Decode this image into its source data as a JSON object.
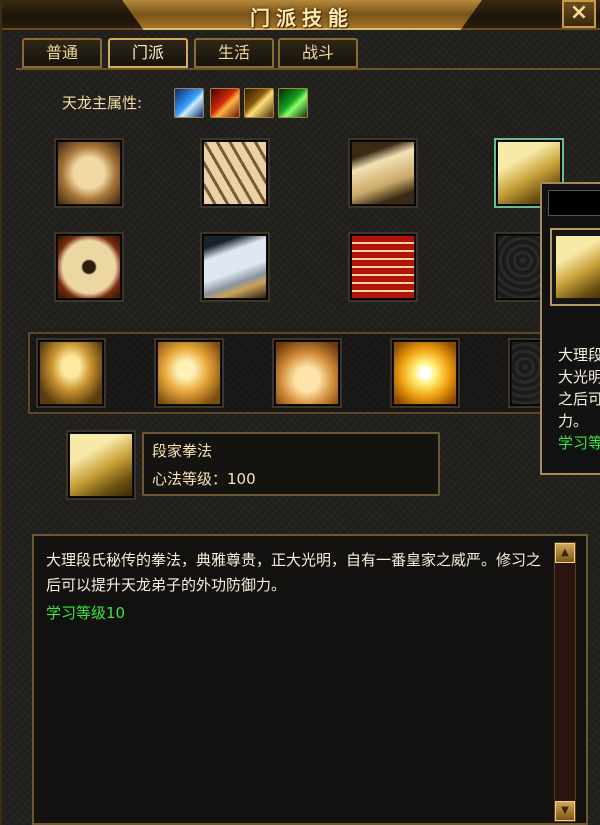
{
  "window": {
    "title": "门派技能",
    "close_label": "×"
  },
  "tabs": [
    {
      "label": "普通",
      "active": false
    },
    {
      "label": "门派",
      "active": true
    },
    {
      "label": "生活",
      "active": false
    },
    {
      "label": "战斗",
      "active": false
    }
  ],
  "attributes": {
    "label": "天龙主属性:",
    "icons": [
      "ice-attribute-icon",
      "fire-attribute-icon",
      "lightning-attribute-icon",
      "poison-attribute-icon"
    ]
  },
  "skill_grid": {
    "row1": [
      "scroll-icon",
      "scroll-bundle-icon",
      "open-book-icon",
      "manual-book-icon"
    ],
    "row2": [
      "figure-scroll-icon",
      "blue-book-icon",
      "red-book-stack-icon",
      "empty-slot-icon"
    ]
  },
  "passive_skills": [
    "golden-armor-icon",
    "fist-icon",
    "palm-icon",
    "light-burst-icon",
    "empty-slot-icon"
  ],
  "selected_skill": {
    "name": "段家拳法",
    "level_text": "心法等级：100"
  },
  "description": {
    "text": "大理段氏秘传的拳法，典雅尊贵，正大光明，自有一番皇家之威严。修习之后可以提升天龙弟子的外功防御力。",
    "learn_level": "学习等级10"
  },
  "tooltip": {
    "lines": [
      "大理段",
      "大光明",
      "之后可",
      "力。"
    ],
    "learn_level": "学习等"
  },
  "colors": {
    "gold_text": "#f6dfa4",
    "green_text": "#39e639",
    "frame": "#6b5730"
  }
}
